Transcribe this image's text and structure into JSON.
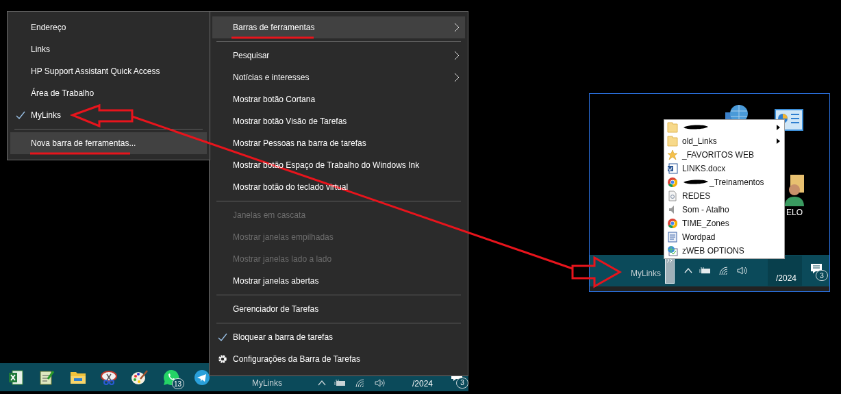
{
  "toolbars_submenu": {
    "groups": [
      [
        {
          "label": "Endereço",
          "checked": false,
          "highlighted": false
        },
        {
          "label": "Links",
          "checked": false,
          "highlighted": false
        },
        {
          "label": "HP Support Assistant Quick Access",
          "checked": false,
          "highlighted": false
        },
        {
          "label": "Área de Trabalho",
          "checked": false,
          "highlighted": false
        },
        {
          "label": "MyLinks",
          "checked": true,
          "highlighted": false
        }
      ],
      [
        {
          "label": "Nova barra de ferramentas...",
          "checked": false,
          "highlighted": true
        }
      ]
    ]
  },
  "context_menu": {
    "groups": [
      [
        {
          "kind": "submenu",
          "label": "Barras de ferramentas",
          "checked": false,
          "disabled": false,
          "highlighted": true
        }
      ],
      [
        {
          "kind": "submenu",
          "label": "Pesquisar",
          "checked": false,
          "disabled": false,
          "highlighted": false
        },
        {
          "kind": "submenu",
          "label": "Notícias e interesses",
          "checked": false,
          "disabled": false,
          "highlighted": false
        },
        {
          "kind": "command",
          "label": "Mostrar botão Cortana",
          "checked": false,
          "disabled": false,
          "highlighted": false
        },
        {
          "kind": "command",
          "label": "Mostrar botão Visão de Tarefas",
          "checked": false,
          "disabled": false,
          "highlighted": false
        },
        {
          "kind": "command",
          "label": "Mostrar Pessoas na barra de tarefas",
          "checked": false,
          "disabled": false,
          "highlighted": false
        },
        {
          "kind": "command",
          "label": "Mostrar botão Espaço de Trabalho do Windows Ink",
          "checked": false,
          "disabled": false,
          "highlighted": false
        },
        {
          "kind": "command",
          "label": "Mostrar botão do teclado virtual",
          "checked": false,
          "disabled": false,
          "highlighted": false
        }
      ],
      [
        {
          "kind": "command",
          "label": "Janelas em cascata",
          "checked": false,
          "disabled": true,
          "highlighted": false
        },
        {
          "kind": "command",
          "label": "Mostrar janelas empilhadas",
          "checked": false,
          "disabled": true,
          "highlighted": false
        },
        {
          "kind": "command",
          "label": "Mostrar janelas lado a lado",
          "checked": false,
          "disabled": true,
          "highlighted": false
        },
        {
          "kind": "command",
          "label": "Mostrar janelas abertas",
          "checked": false,
          "disabled": false,
          "highlighted": false
        }
      ],
      [
        {
          "kind": "command",
          "label": "Gerenciador de Tarefas",
          "checked": false,
          "disabled": false,
          "highlighted": false
        }
      ],
      [
        {
          "kind": "command",
          "label": "Bloquear a barra de tarefas",
          "checked": true,
          "disabled": false,
          "highlighted": false
        },
        {
          "kind": "settings",
          "label": "Configurações da Barra de Tarefas",
          "checked": false,
          "disabled": false,
          "highlighted": false
        }
      ]
    ]
  },
  "taskbar": {
    "apps": [
      {
        "kind": "excel"
      },
      {
        "kind": "notepad"
      },
      {
        "kind": "folder"
      },
      {
        "kind": "snip"
      },
      {
        "kind": "paint"
      },
      {
        "kind": "whatsapp",
        "badge": "13"
      },
      {
        "kind": "telegram"
      }
    ],
    "toolbar_label": "MyLinks",
    "date": "/2024",
    "notification_count": "3"
  },
  "preview": {
    "desktop_label": "ELO",
    "menu_items": [
      {
        "kind": "folder",
        "redacted": true,
        "has_submenu": true
      },
      {
        "kind": "folder",
        "label": "old_Links",
        "redacted": false,
        "has_submenu": true
      },
      {
        "kind": "star",
        "label": "_FAVORITOS WEB",
        "redacted": false,
        "has_submenu": false
      },
      {
        "kind": "word",
        "label": "LINKS.docx",
        "redacted": false,
        "has_submenu": false
      },
      {
        "kind": "chrome",
        "label": "_Treinamentos",
        "redacted": true,
        "has_submenu": false
      },
      {
        "kind": "file",
        "label": "REDES",
        "redacted": false,
        "has_submenu": false
      },
      {
        "kind": "speaker",
        "label": "Som - Atalho",
        "redacted": false,
        "has_submenu": false
      },
      {
        "kind": "chrome",
        "label": "TIME_Zones",
        "redacted": false,
        "has_submenu": false
      },
      {
        "kind": "wordpad",
        "label": "Wordpad",
        "redacted": false,
        "has_submenu": false
      },
      {
        "kind": "web",
        "label": "zWEB OPTIONS",
        "redacted": false,
        "has_submenu": false
      }
    ],
    "taskbar": {
      "toolbar_label": "MyLinks",
      "date": "/2024",
      "notification_count": "3"
    }
  }
}
